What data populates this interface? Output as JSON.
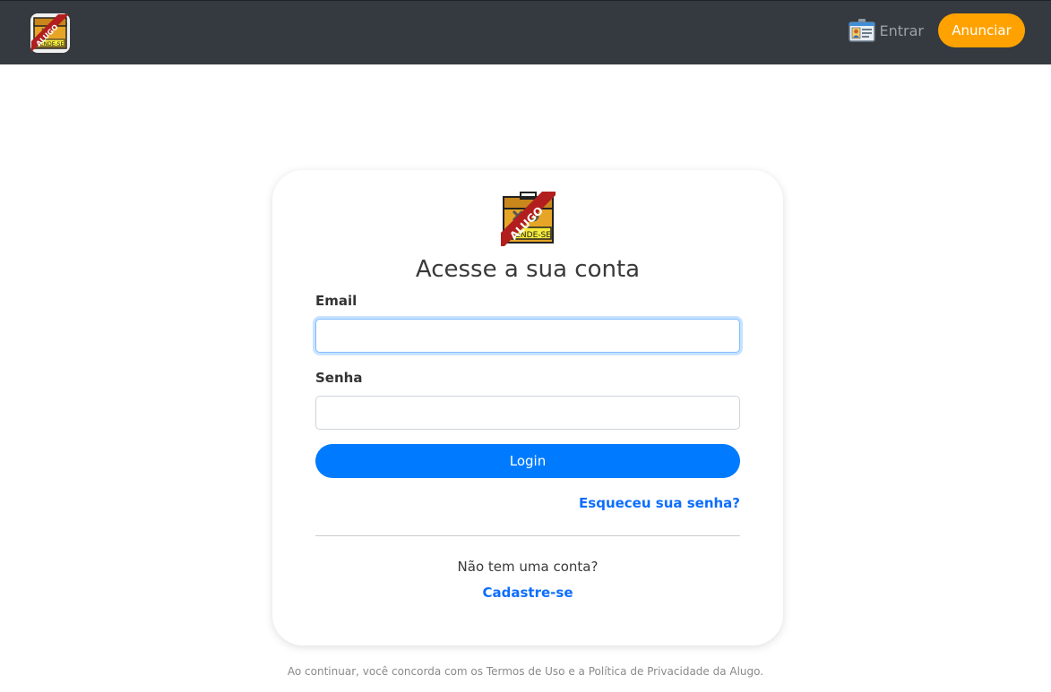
{
  "header": {
    "logo_alt": "ALUGO",
    "logo_badge": "ALUGO",
    "logo_sign": "VENDE-SE",
    "login_label": "Entrar",
    "advertise_label": "Anunciar"
  },
  "colors": {
    "topbar": "#343a40",
    "accent_orange": "#ffa200",
    "primary_blue": "#007bff",
    "link_blue": "#0d6efd"
  },
  "login_card": {
    "title": "Acesse a sua conta",
    "email_label": "Email",
    "email_value": "",
    "password_label": "Senha",
    "password_value": "",
    "login_button": "Login",
    "forgot_password": "Esqueceu sua senha?",
    "no_account": "Não tem uma conta?",
    "signup": "Cadastre-se"
  },
  "footer": {
    "terms": "Ao continuar, você concorda com os Termos de Uso e a Política de Privacidade da Alugo."
  }
}
